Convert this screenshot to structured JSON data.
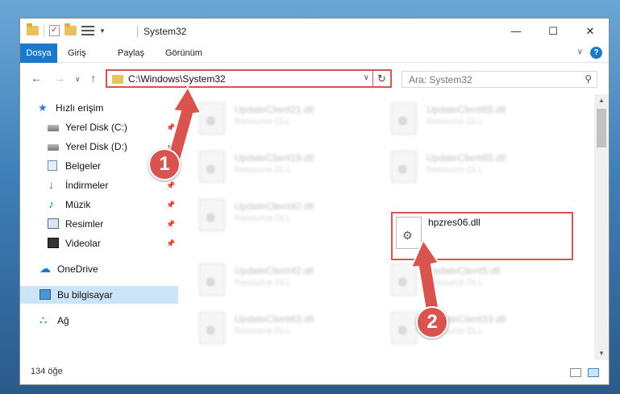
{
  "window": {
    "title": "System32",
    "controls": {
      "minimize": "—",
      "maximize": "☐",
      "close": "✕"
    }
  },
  "ribbon": {
    "tabs": [
      "Dosya",
      "Giriş",
      "Paylaş",
      "Görünüm"
    ],
    "chevron": "∨",
    "help": "?"
  },
  "nav": {
    "back": "←",
    "forward": "→",
    "recent": "∨",
    "up": "↑",
    "address": "C:\\Windows\\System32",
    "address_dropdown": "∨",
    "refresh": "↻",
    "search_placeholder": "Ara: System32",
    "search_icon": "⚲"
  },
  "sidebar": {
    "items": [
      {
        "label": "Hızlı erişim",
        "icon": "star-icon",
        "glyph": "★",
        "pinned": false
      },
      {
        "label": "Yerel Disk (C:)",
        "icon": "disk-icon",
        "glyph": "",
        "pinned": true
      },
      {
        "label": "Yerel Disk (D:)",
        "icon": "disk-icon",
        "glyph": "",
        "pinned": true
      },
      {
        "label": "Belgeler",
        "icon": "documents-icon",
        "glyph": "",
        "pinned": true
      },
      {
        "label": "İndirmeler",
        "icon": "download-icon",
        "glyph": "↓",
        "pinned": true
      },
      {
        "label": "Müzik",
        "icon": "music-icon",
        "glyph": "♪",
        "pinned": true
      },
      {
        "label": "Resimler",
        "icon": "pictures-icon",
        "glyph": "",
        "pinned": true
      },
      {
        "label": "Videolar",
        "icon": "videos-icon",
        "glyph": "",
        "pinned": true
      },
      {
        "label": "OneDrive",
        "icon": "onedrive-icon",
        "glyph": "☁",
        "pinned": false
      },
      {
        "label": "Bu bilgisayar",
        "icon": "this-pc-icon",
        "glyph": "",
        "pinned": false
      },
      {
        "label": "Ağ",
        "icon": "network-icon",
        "glyph": "⛬",
        "pinned": false
      }
    ],
    "pin_glyph": "📌"
  },
  "files": [
    {
      "name": "UpdateClient21.dll",
      "desc": "Resource DLL"
    },
    {
      "name": "UpdateClient65.dll",
      "desc": "Resource DLL"
    },
    {
      "name": "UpdateClient19.dll",
      "desc": "Resource DLL"
    },
    {
      "name": "UpdateClient65.dll",
      "desc": "Resource DLL"
    },
    {
      "name": "UpdateClient42.dll",
      "desc": "Resource DLL"
    },
    {
      "name": "hpzres06.dll",
      "desc": ""
    },
    {
      "name": "UpdateClient42.dll",
      "desc": "Resource DLL"
    },
    {
      "name": "UpdateClient5.dll",
      "desc": "Resource DLL"
    },
    {
      "name": "UpdateClient63.dll",
      "desc": "Resource DLL"
    },
    {
      "name": "UpdateClient19.dll",
      "desc": "Resource DLL"
    }
  ],
  "status": {
    "count": "134 öğe"
  },
  "annotations": {
    "badge1": "1",
    "badge2": "2",
    "color": "#d9534f"
  }
}
